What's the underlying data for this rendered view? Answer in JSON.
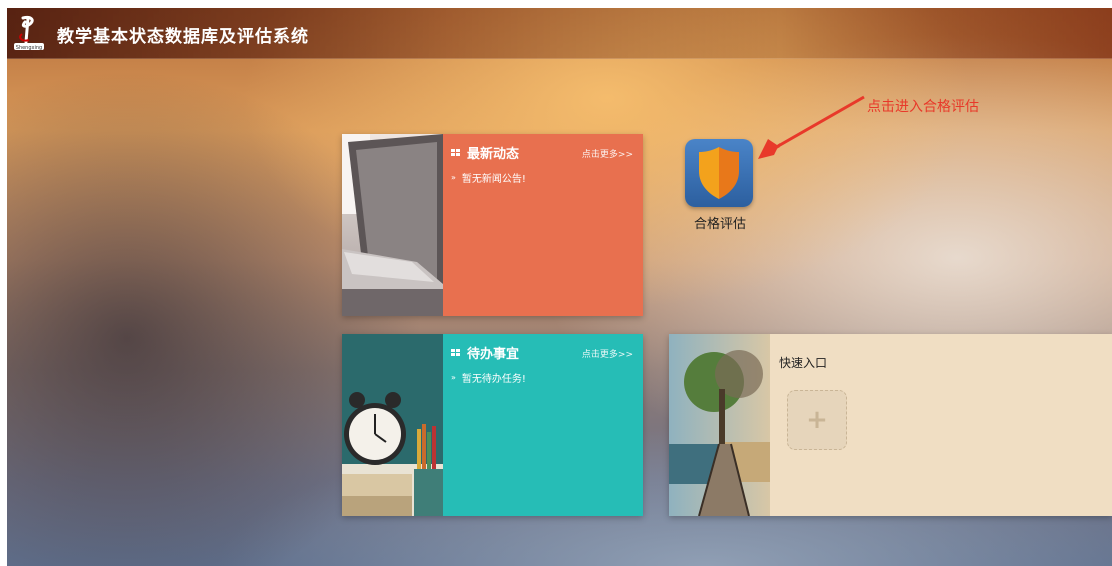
{
  "header": {
    "logo_icon": "shengxing-logo-icon",
    "title": "教学基本状态数据库及评估系统"
  },
  "news": {
    "title": "最新动态",
    "more": "点击更多>>",
    "empty": "暂无新闻公告!",
    "bg_color": "#e8704f"
  },
  "todo": {
    "title": "待办事宜",
    "more": "点击更多>>",
    "empty": "暂无待办任务!",
    "bg_color": "#26bdb6"
  },
  "quick": {
    "title": "快速入口",
    "add_label": "+",
    "bg_color": "#f0dec3"
  },
  "apps": [
    {
      "label": "合格评估",
      "icon": "shield-icon"
    }
  ],
  "annotation": {
    "text": "点击进入合格评估",
    "color": "#e8392a"
  }
}
